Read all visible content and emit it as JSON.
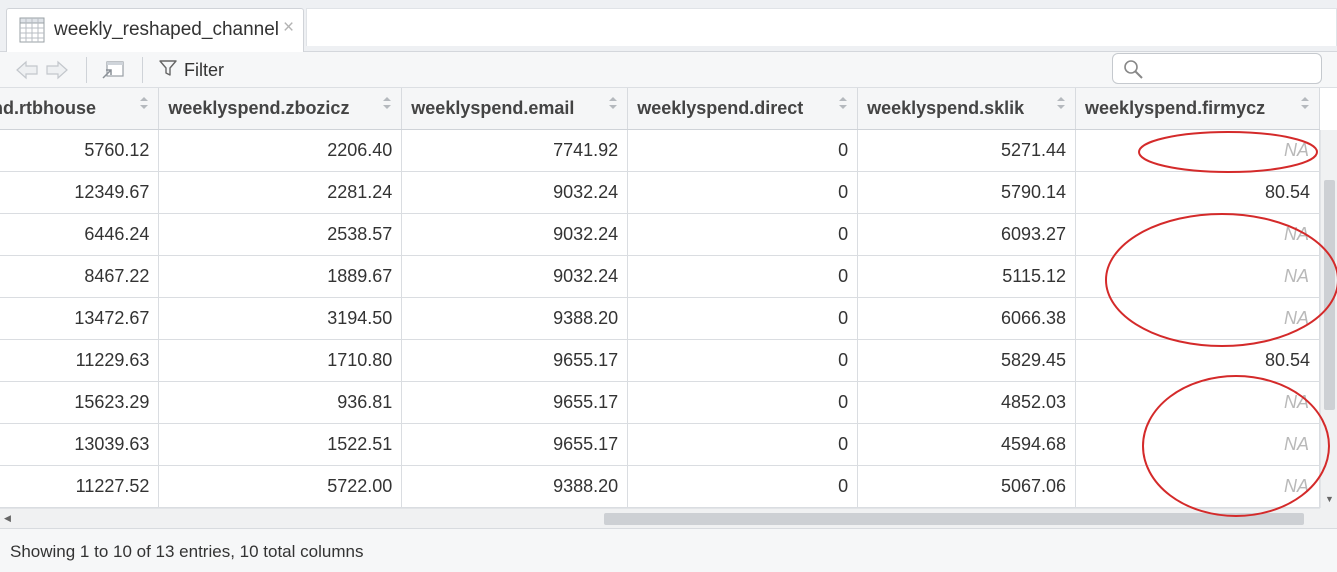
{
  "tab": {
    "title": "weekly_reshaped_channel",
    "close_glyph": "×",
    "icon": "grid-table-icon"
  },
  "toolbar": {
    "back_icon": "arrow-left-icon",
    "forward_icon": "arrow-right-icon",
    "popout_icon": "popout-window-icon",
    "filter_label": "Filter",
    "filter_icon": "funnel-icon",
    "search_placeholder": "",
    "search_icon": "magnifier-icon"
  },
  "table": {
    "columns": [
      "end.rtbhouse",
      "weeklyspend.zbozicz",
      "weeklyspend.email",
      "weeklyspend.direct",
      "weeklyspend.sklik",
      "weeklyspend.firmycz"
    ],
    "rows": [
      [
        "5760.12",
        "2206.40",
        "7741.92",
        "0",
        "5271.44",
        "NA"
      ],
      [
        "12349.67",
        "2281.24",
        "9032.24",
        "0",
        "5790.14",
        "80.54"
      ],
      [
        "6446.24",
        "2538.57",
        "9032.24",
        "0",
        "6093.27",
        "NA"
      ],
      [
        "8467.22",
        "1889.67",
        "9032.24",
        "0",
        "5115.12",
        "NA"
      ],
      [
        "13472.67",
        "3194.50",
        "9388.20",
        "0",
        "6066.38",
        "NA"
      ],
      [
        "11229.63",
        "1710.80",
        "9655.17",
        "0",
        "5829.45",
        "80.54"
      ],
      [
        "15623.29",
        "936.81",
        "9655.17",
        "0",
        "4852.03",
        "NA"
      ],
      [
        "13039.63",
        "1522.51",
        "9655.17",
        "0",
        "4594.68",
        "NA"
      ],
      [
        "11227.52",
        "5722.00",
        "9388.20",
        "0",
        "5067.06",
        "NA"
      ],
      [
        "",
        "",
        "",
        "",
        "",
        ""
      ]
    ]
  },
  "footer": {
    "status": "Showing 1 to 10 of 13 entries, 10 total columns"
  },
  "colors": {
    "annotation": "#d42a2a",
    "na_text": "#b9b9b9",
    "header_bg": "#f5f6f7"
  }
}
